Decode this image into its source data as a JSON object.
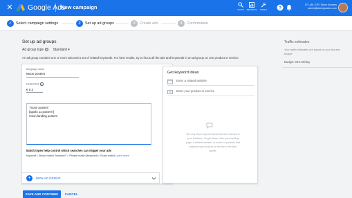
{
  "topbar": {
    "brand": "Google Ads",
    "page_title": "New campaign",
    "tools": [
      {
        "label": "GO TO",
        "icon": "search-icon"
      },
      {
        "label": "REPORTS",
        "icon": "reports-icon"
      },
      {
        "label": "TOOLS",
        "icon": "wrench-icon"
      }
    ],
    "account_id": "571-481-0767 Stone Growers",
    "account_email": "admin@stonegrowers.com",
    "accent": "#1a73e8"
  },
  "stepper": {
    "steps": [
      {
        "num": "✓",
        "label": "Select campaign settings",
        "state": "done"
      },
      {
        "num": "2",
        "label": "Set up ad groups",
        "state": "active"
      },
      {
        "num": "3",
        "label": "Create ads",
        "state": "pending"
      },
      {
        "num": "4",
        "label": "Confirmation",
        "state": "pending"
      }
    ]
  },
  "main": {
    "section_title": "Set up ad groups",
    "ad_group_type_label": "Ad group type",
    "ad_group_type_value": "Standard",
    "info_text": "An ad group contains one or more ads and a set of related keywords. For best results, try to focus all the ads and keywords in an ad group on one product or service.",
    "ad_group_name_label": "Ad group name",
    "ad_group_name_value": "Moon posters",
    "default_bid_label": "Default bid",
    "default_bid_value": "€ 0.2",
    "keywords": [
      "\"moon posters\"",
      "[apollo 11 posters\"]",
      "moon landing posters"
    ],
    "match_title": "Match types help control which searches can trigger your ads",
    "match_text": "keyword = Broad match   \"keyword\" = Phrase match   [keyword] = Exact match",
    "learn_more": "Learn more",
    "keyword_ideas": {
      "title": "Get keyword ideas",
      "website_placeholder": "Enter a related website",
      "product_placeholder": "Enter your product or service",
      "empty_text": "We only show keyword ideas that are relevant to your business. To get ideas, enter your landing page, a related website, or words or phrases that describe your product or service in the field above."
    },
    "new_ad_group": "NEW AD GROUP"
  },
  "actions": {
    "save": "SAVE AND CONTINUE",
    "cancel": "CANCEL"
  },
  "sidebar": {
    "title": "Traffic estimates",
    "description": "Your traffic estimates are based on your bid and budget",
    "budget": "Budget:  €10.00/day"
  }
}
